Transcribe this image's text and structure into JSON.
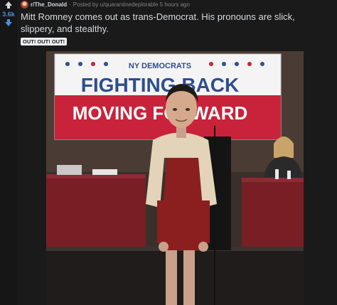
{
  "vote": {
    "score": "3.6k"
  },
  "post": {
    "subreddit": "r/The_Donald",
    "posted_by_prefix": "Posted by",
    "author": "u/quarantinedeplorable",
    "time": "5 hours ago",
    "title": "Mitt Romney comes out as trans-Democrat. His pronouns are slick, slippery, and stealthy.",
    "flair": "OUT! OUT! OUT!"
  },
  "image": {
    "banner_top": "NY DEMOCRATS",
    "banner_middle": "FIGHTING BACK",
    "banner_bottom": "MOVING FORWARD"
  },
  "colors": {
    "upvote": "#ff4500",
    "downvote": "#4a90d9",
    "score": "#4a90d9",
    "background": "#1a1a1b",
    "banner_red": "#c8233a",
    "banner_blue": "#2f4e8c"
  }
}
